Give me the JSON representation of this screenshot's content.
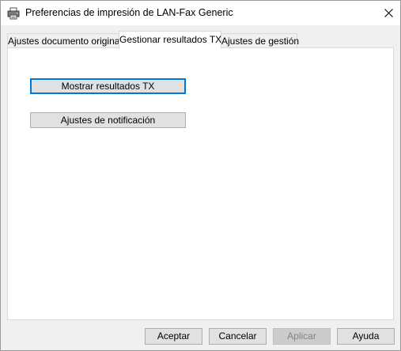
{
  "window": {
    "title": "Preferencias de impresión de LAN-Fax Generic",
    "title_icon": "printer-icon",
    "close_icon": "close-icon"
  },
  "tabs": [
    {
      "label": "Ajustes documento original",
      "active": false
    },
    {
      "label": "Gestionar resultados TX",
      "active": true
    },
    {
      "label": "Ajustes de gestión",
      "active": false
    }
  ],
  "panel": {
    "show_results_label": "Mostrar resultados TX",
    "notification_settings_label": "Ajustes de notificación"
  },
  "footer": {
    "accept_label": "Aceptar",
    "cancel_label": "Cancelar",
    "apply_label": "Aplicar",
    "apply_disabled": true,
    "help_label": "Ayuda"
  },
  "colors": {
    "focus_border": "#0078d7",
    "dialog_background": "#f0f0f0",
    "panel_background": "#ffffff"
  }
}
